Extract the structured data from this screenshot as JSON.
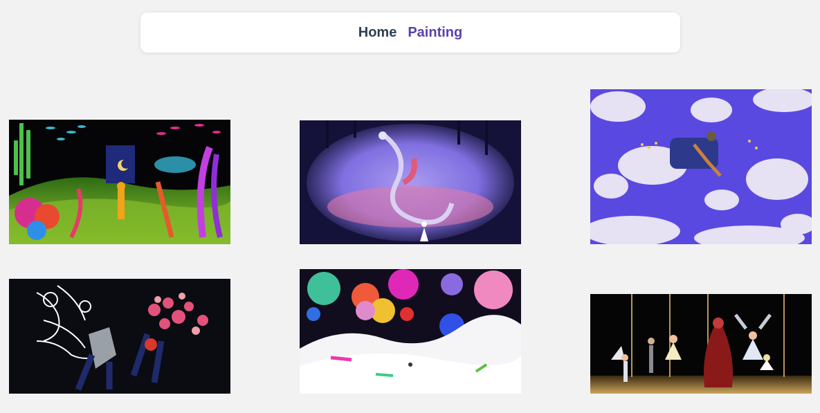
{
  "nav": {
    "home_label": "Home",
    "painting_label": "Painting"
  },
  "colors": {
    "page_background": "#f2f2f2",
    "nav_home": "#2c3e50",
    "nav_painting_active": "#5b3fb0"
  },
  "gallery": {
    "images": [
      {
        "name": "underwater-garden-painting"
      },
      {
        "name": "dragon-in-cave-painting"
      },
      {
        "name": "sky-clouds-sleeper-painting"
      },
      {
        "name": "flower-bouquet-dark-painting"
      },
      {
        "name": "cosmic-flowers-snow-painting"
      },
      {
        "name": "ballet-dancers-stage-painting"
      }
    ]
  }
}
